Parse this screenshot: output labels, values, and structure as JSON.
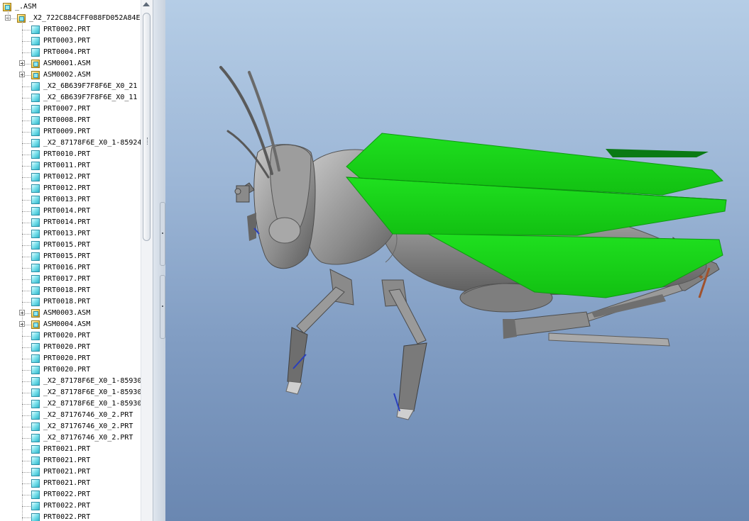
{
  "model_tree": {
    "items": [
      {
        "label": "_.ASM",
        "type": "asm",
        "indent": 0,
        "expander": "none"
      },
      {
        "label": "_X2_722C884CFF088FD052A84E",
        "type": "asm",
        "indent": 1,
        "expander": "minus"
      },
      {
        "label": "PRT0002.PRT",
        "type": "part",
        "indent": 2,
        "expander": "none"
      },
      {
        "label": "PRT0003.PRT",
        "type": "part",
        "indent": 2,
        "expander": "none"
      },
      {
        "label": "PRT0004.PRT",
        "type": "part",
        "indent": 2,
        "expander": "none"
      },
      {
        "label": "ASM0001.ASM",
        "type": "asm",
        "indent": 2,
        "expander": "plus"
      },
      {
        "label": "ASM0002.ASM",
        "type": "asm",
        "indent": 2,
        "expander": "plus"
      },
      {
        "label": "_X2_6B639F7F8F6E_X0_21",
        "type": "part",
        "indent": 2,
        "expander": "none"
      },
      {
        "label": "_X2_6B639F7F8F6E_X0_11",
        "type": "part",
        "indent": 2,
        "expander": "none"
      },
      {
        "label": "PRT0007.PRT",
        "type": "part",
        "indent": 2,
        "expander": "none"
      },
      {
        "label": "PRT0008.PRT",
        "type": "part",
        "indent": 2,
        "expander": "none"
      },
      {
        "label": "PRT0009.PRT",
        "type": "part",
        "indent": 2,
        "expander": "none"
      },
      {
        "label": "_X2_87178F6E_X0_1-85924",
        "type": "part",
        "indent": 2,
        "expander": "none"
      },
      {
        "label": "PRT0010.PRT",
        "type": "part",
        "indent": 2,
        "expander": "none"
      },
      {
        "label": "PRT0011.PRT",
        "type": "part",
        "indent": 2,
        "expander": "none"
      },
      {
        "label": "PRT0012.PRT",
        "type": "part",
        "indent": 2,
        "expander": "none"
      },
      {
        "label": "PRT0012.PRT",
        "type": "part",
        "indent": 2,
        "expander": "none"
      },
      {
        "label": "PRT0013.PRT",
        "type": "part",
        "indent": 2,
        "expander": "none"
      },
      {
        "label": "PRT0014.PRT",
        "type": "part",
        "indent": 2,
        "expander": "none"
      },
      {
        "label": "PRT0014.PRT",
        "type": "part",
        "indent": 2,
        "expander": "none"
      },
      {
        "label": "PRT0013.PRT",
        "type": "part",
        "indent": 2,
        "expander": "none"
      },
      {
        "label": "PRT0015.PRT",
        "type": "part",
        "indent": 2,
        "expander": "none"
      },
      {
        "label": "PRT0015.PRT",
        "type": "part",
        "indent": 2,
        "expander": "none"
      },
      {
        "label": "PRT0016.PRT",
        "type": "part",
        "indent": 2,
        "expander": "none"
      },
      {
        "label": "PRT0017.PRT",
        "type": "part",
        "indent": 2,
        "expander": "none"
      },
      {
        "label": "PRT0018.PRT",
        "type": "part",
        "indent": 2,
        "expander": "none"
      },
      {
        "label": "PRT0018.PRT",
        "type": "part",
        "indent": 2,
        "expander": "none"
      },
      {
        "label": "ASM0003.ASM",
        "type": "asm",
        "indent": 2,
        "expander": "plus"
      },
      {
        "label": "ASM0004.ASM",
        "type": "asm",
        "indent": 2,
        "expander": "plus"
      },
      {
        "label": "PRT0020.PRT",
        "type": "part",
        "indent": 2,
        "expander": "none"
      },
      {
        "label": "PRT0020.PRT",
        "type": "part",
        "indent": 2,
        "expander": "none"
      },
      {
        "label": "PRT0020.PRT",
        "type": "part",
        "indent": 2,
        "expander": "none"
      },
      {
        "label": "PRT0020.PRT",
        "type": "part",
        "indent": 2,
        "expander": "none"
      },
      {
        "label": "_X2_87178F6E_X0_1-85930",
        "type": "part",
        "indent": 2,
        "expander": "none"
      },
      {
        "label": "_X2_87178F6E_X0_1-85930",
        "type": "part",
        "indent": 2,
        "expander": "none"
      },
      {
        "label": "_X2_87178F6E_X0_1-85930",
        "type": "part",
        "indent": 2,
        "expander": "none"
      },
      {
        "label": "_X2_87176746_X0_2.PRT",
        "type": "part",
        "indent": 2,
        "expander": "none"
      },
      {
        "label": "_X2_87176746_X0_2.PRT",
        "type": "part",
        "indent": 2,
        "expander": "none"
      },
      {
        "label": "_X2_87176746_X0_2.PRT",
        "type": "part",
        "indent": 2,
        "expander": "none"
      },
      {
        "label": "PRT0021.PRT",
        "type": "part",
        "indent": 2,
        "expander": "none"
      },
      {
        "label": "PRT0021.PRT",
        "type": "part",
        "indent": 2,
        "expander": "none"
      },
      {
        "label": "PRT0021.PRT",
        "type": "part",
        "indent": 2,
        "expander": "none"
      },
      {
        "label": "PRT0021.PRT",
        "type": "part",
        "indent": 2,
        "expander": "none"
      },
      {
        "label": "PRT0022.PRT",
        "type": "part",
        "indent": 2,
        "expander": "none"
      },
      {
        "label": "PRT0022.PRT",
        "type": "part",
        "indent": 2,
        "expander": "none"
      },
      {
        "label": "PRT0022.PRT",
        "type": "part",
        "indent": 2,
        "expander": "none"
      }
    ]
  },
  "icons": {
    "part": "part-icon",
    "asm": "assembly-icon",
    "expand": "tree-expand-icon",
    "collapse": "tree-collapse-icon"
  },
  "viewport": {
    "colors": {
      "background_top": "#b5cde6",
      "background_bottom": "#6a87b1",
      "wing": "#19d21a",
      "wing_dark": "#0a7a14",
      "body": "#8f8f8f",
      "leg_accent": "#a0522d"
    }
  }
}
